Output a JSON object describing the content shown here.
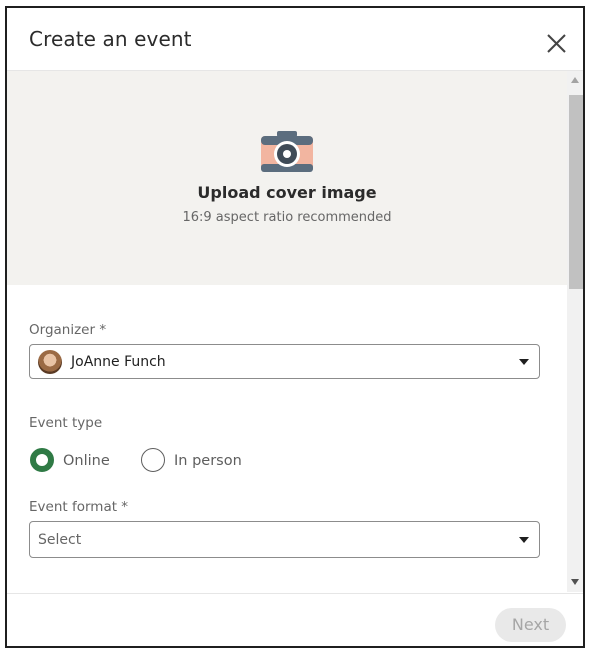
{
  "dialog": {
    "title": "Create an event",
    "close_icon": "close-icon"
  },
  "cover": {
    "icon": "camera-icon",
    "title": "Upload cover image",
    "subtitle": "16:9 aspect ratio recommended"
  },
  "organizer": {
    "label": "Organizer *",
    "value": "JoAnne Funch",
    "avatar_icon": "avatar"
  },
  "event_type": {
    "label": "Event type",
    "options": [
      {
        "label": "Online",
        "selected": true
      },
      {
        "label": "In person",
        "selected": false
      }
    ]
  },
  "event_format": {
    "label": "Event format *",
    "placeholder": "Select"
  },
  "footer": {
    "next_label": "Next"
  },
  "colors": {
    "accent_green": "#2f7a45",
    "cover_background": "#f3f2ef",
    "disabled_button": "#e9e9e9"
  }
}
